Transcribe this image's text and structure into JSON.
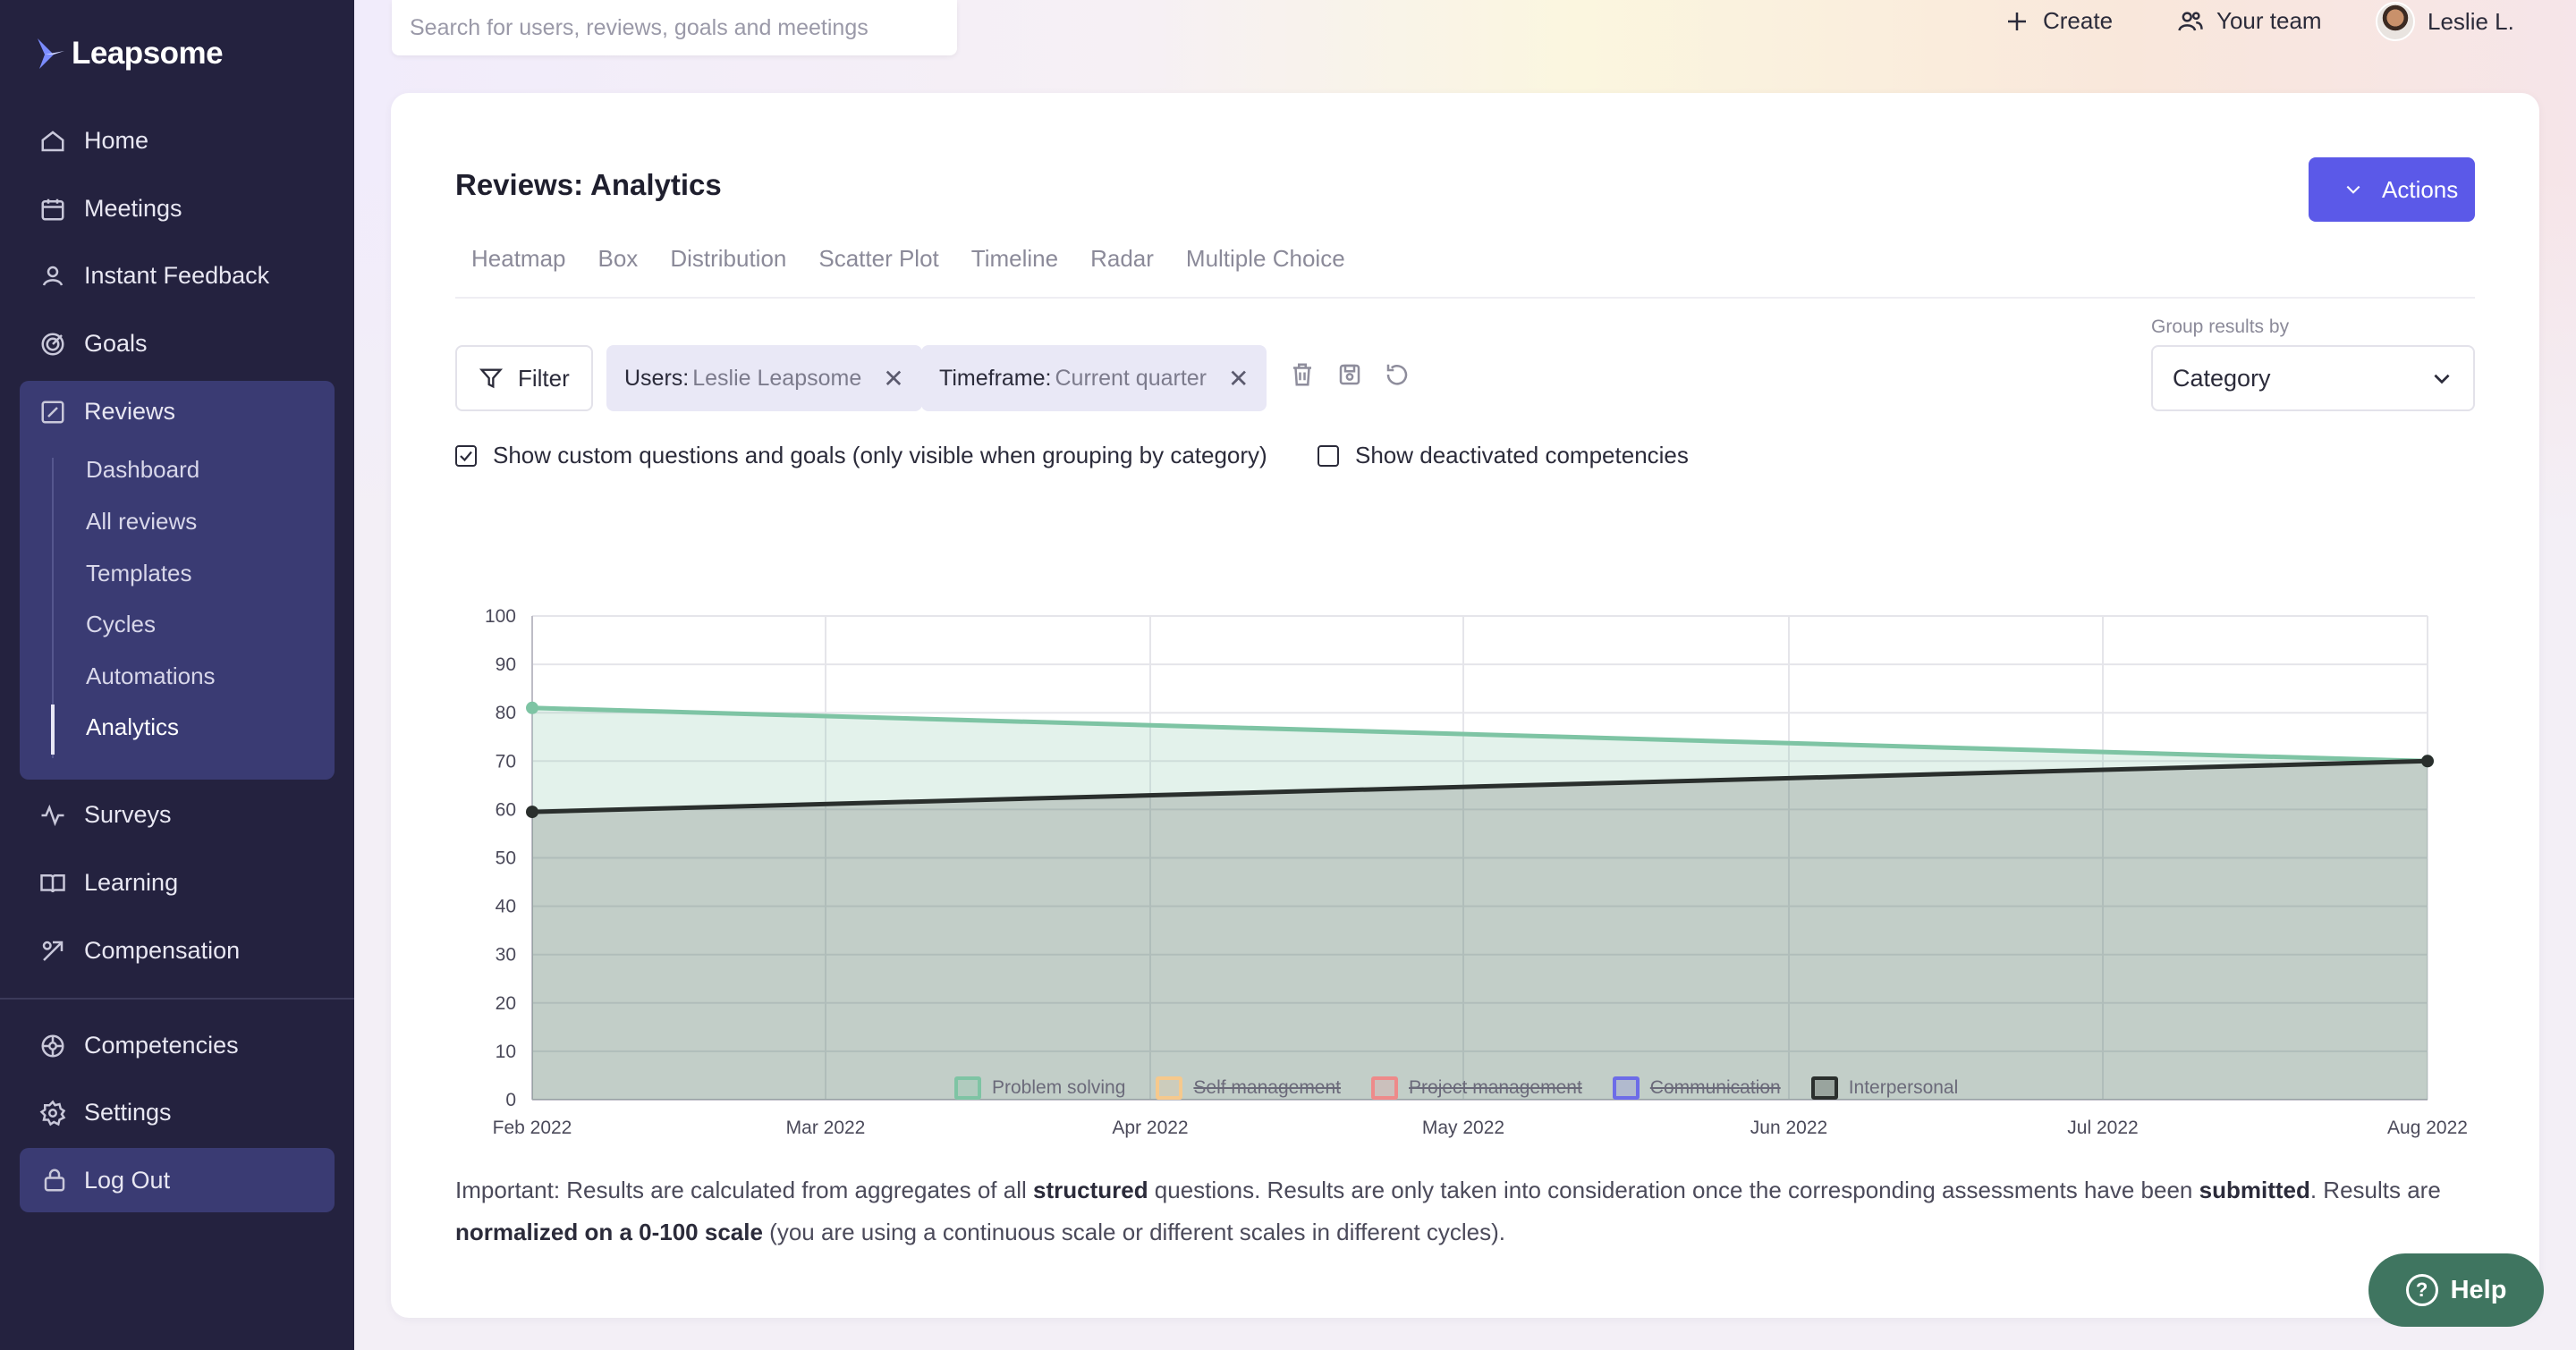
{
  "brand": {
    "name": "Leapsome"
  },
  "search": {
    "placeholder": "Search for users, reviews, goals and meetings"
  },
  "topbar": {
    "create": "Create",
    "team": "Your team",
    "user": "Leslie L."
  },
  "sidebar": {
    "items": [
      {
        "label": "Home",
        "icon": "home-icon"
      },
      {
        "label": "Meetings",
        "icon": "meetings-icon"
      },
      {
        "label": "Instant Feedback",
        "icon": "feedback-icon"
      },
      {
        "label": "Goals",
        "icon": "goals-icon"
      },
      {
        "label": "Reviews",
        "icon": "reviews-icon"
      }
    ],
    "review_sub": [
      "Dashboard",
      "All reviews",
      "Templates",
      "Cycles",
      "Automations",
      "Analytics"
    ],
    "more": [
      {
        "label": "Surveys",
        "icon": "surveys-icon"
      },
      {
        "label": "Learning",
        "icon": "learning-icon"
      },
      {
        "label": "Compensation",
        "icon": "compensation-icon"
      }
    ],
    "bottom": [
      {
        "label": "Competencies",
        "icon": "competencies-icon"
      },
      {
        "label": "Settings",
        "icon": "settings-icon"
      }
    ],
    "logout": "Log Out"
  },
  "page": {
    "title": "Reviews: Analytics",
    "actions": "Actions",
    "tabs": [
      "Heatmap",
      "Box",
      "Distribution",
      "Scatter Plot",
      "Timeline",
      "Radar",
      "Multiple Choice"
    ]
  },
  "filters": {
    "filter_label": "Filter",
    "chips": [
      {
        "key": "Users:",
        "value": "Leslie Leapsome"
      },
      {
        "key": "Timeframe:",
        "value": "Current quarter"
      }
    ],
    "group_label": "Group results by",
    "group_value": "Category",
    "check1": {
      "label": "Show custom questions and goals (only visible when grouping by category)",
      "checked": true
    },
    "check2": {
      "label": "Show deactivated competencies",
      "checked": false
    }
  },
  "chart_data": {
    "type": "area",
    "x": [
      "Feb 2022",
      "Mar 2022",
      "Apr 2022",
      "May 2022",
      "Jun 2022",
      "Jul 2022",
      "Aug 2022"
    ],
    "ylim": [
      0,
      100
    ],
    "yticks": [
      0,
      10,
      20,
      30,
      40,
      50,
      60,
      70,
      80,
      90,
      100
    ],
    "grid": true,
    "legend_placement": "bottom-center",
    "series": [
      {
        "name": "Problem solving",
        "color": "#7ec4a4",
        "visible": true,
        "points": [
          [
            "Feb 2022",
            81
          ],
          [
            "Aug 2022",
            70
          ]
        ]
      },
      {
        "name": "Self management",
        "color": "#f6c98d",
        "visible": false,
        "points": []
      },
      {
        "name": "Project management",
        "color": "#ee8a8a",
        "visible": false,
        "points": []
      },
      {
        "name": "Communication",
        "color": "#6d6ce8",
        "visible": false,
        "points": []
      },
      {
        "name": "Interpersonal",
        "color": "#2a2f2d",
        "visible": true,
        "points": [
          [
            "Feb 2022",
            59.5
          ],
          [
            "Aug 2022",
            70
          ]
        ]
      }
    ]
  },
  "note": {
    "p1": "Important: Results are calculated from aggregates of all ",
    "b1": "structured",
    "p2": " questions. Results are only taken into consideration once the corresponding assessments have been ",
    "b2": "submitted",
    "p3": ". Results are ",
    "b3": "normalized on a 0-100 scale",
    "p4": " (you are using a continuous scale or different scales in different cycles)."
  },
  "help": {
    "label": "Help"
  }
}
